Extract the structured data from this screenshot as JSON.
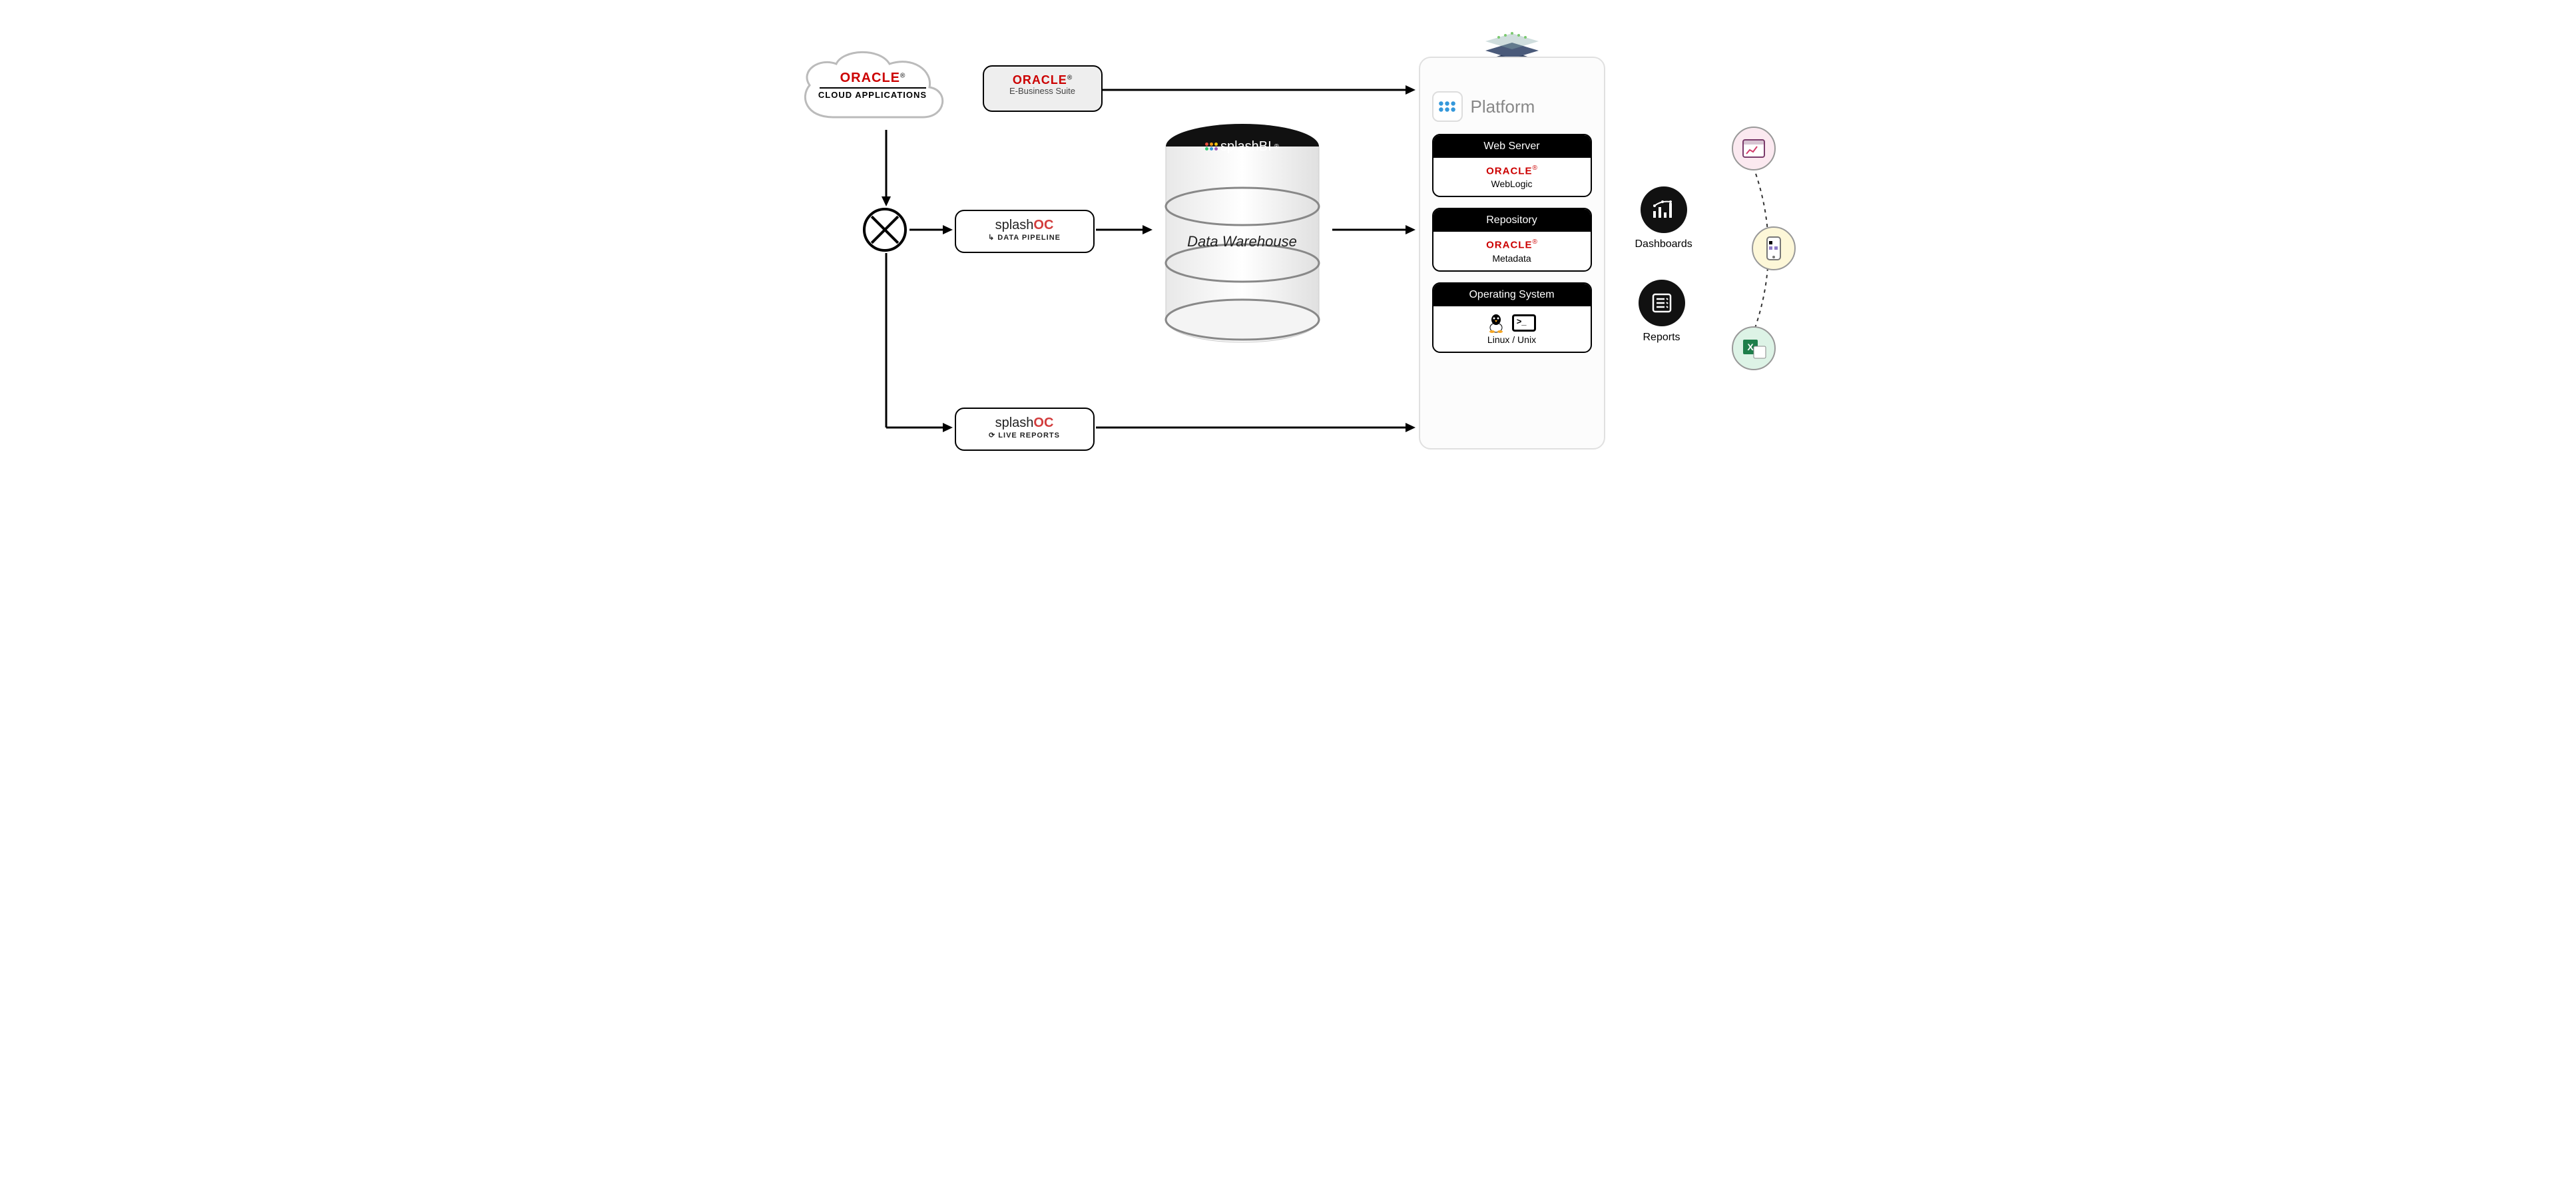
{
  "brand": {
    "oracle": "ORACLE",
    "registered": "®"
  },
  "sources": {
    "cloud_apps": "CLOUD APPLICATIONS",
    "ebs": "E-Business Suite"
  },
  "products": {
    "splash_prefix": "splash",
    "oc_suffix": "OC",
    "pipeline_sub": "DATA PIPELINE",
    "live_sub": "LIVE REPORTS",
    "splashbi": "splashBI"
  },
  "warehouse": {
    "label": "Data Warehouse"
  },
  "platform": {
    "title": "Platform",
    "stacks": [
      {
        "head": "Web Server",
        "brand": "ORACLE",
        "sub": "WebLogic"
      },
      {
        "head": "Repository",
        "brand": "ORACLE",
        "sub": "Metadata"
      },
      {
        "head": "Operating System",
        "brand": "",
        "sub": "Linux / Unix"
      }
    ]
  },
  "outputs": {
    "dashboards": "Dashboards",
    "reports": "Reports"
  }
}
